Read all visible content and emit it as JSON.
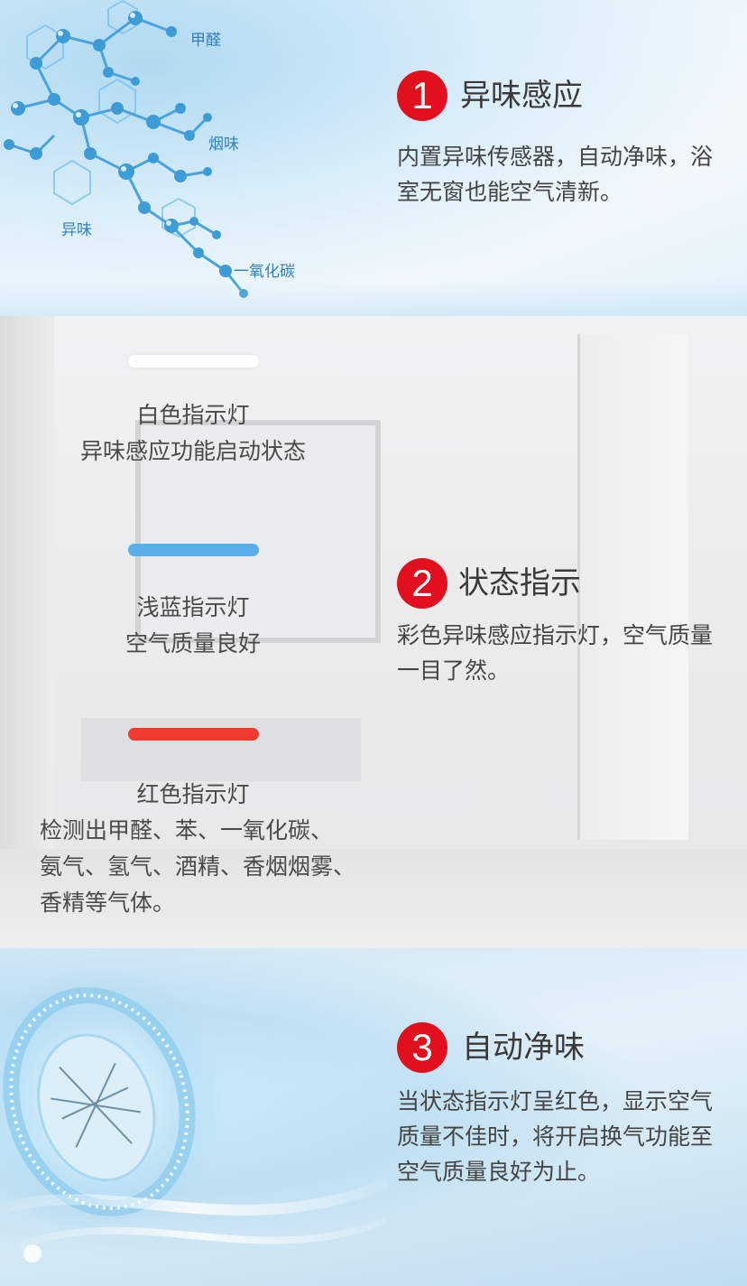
{
  "molecule_labels": [
    "甲醛",
    "烟味",
    "异味",
    "一氧化碳"
  ],
  "features": [
    {
      "number": "1",
      "title": "异味感应",
      "description": "内置异味传感器，自动净味，浴室无窗也能空气清新。"
    },
    {
      "number": "2",
      "title": "状态指示",
      "description": "彩色异味感应指示灯，空气质量一目了然。"
    },
    {
      "number": "3",
      "title": "自动净味",
      "description": "当状态指示灯呈红色，显示空气质量不佳时，将开启换气功能至空气质量良好为止。"
    }
  ],
  "indicators": [
    {
      "color": "#ffffff",
      "name": "白色指示灯",
      "lines": [
        "异味感应功能启动状态"
      ]
    },
    {
      "color": "#5aaeea",
      "name": "浅蓝指示灯",
      "lines": [
        "空气质量良好"
      ]
    },
    {
      "color": "#ee3b2e",
      "name": "红色指示灯",
      "lines": [
        "检测出甲醛、苯、一氧化碳、",
        "氨气、氢气、酒精、香烟烟雾、",
        "香精等气体。"
      ]
    }
  ],
  "colors": {
    "badge": "#e20f1e",
    "molecule": "#3d9bd6"
  }
}
